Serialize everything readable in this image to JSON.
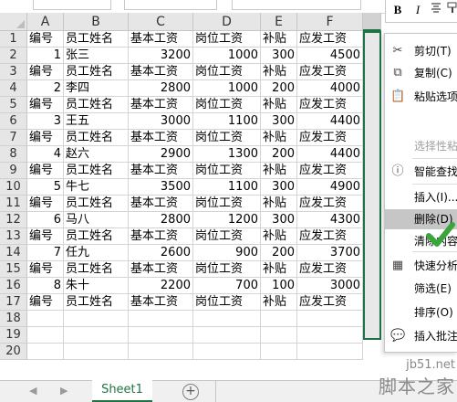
{
  "columns": [
    "A",
    "B",
    "C",
    "D",
    "E",
    "F"
  ],
  "row_numbers": [
    "1",
    "2",
    "3",
    "4",
    "5",
    "6",
    "7",
    "8",
    "9",
    "10",
    "11",
    "12",
    "13",
    "14",
    "15",
    "16",
    "17",
    "18",
    "19",
    "20"
  ],
  "header": [
    "编号",
    "员工姓名",
    "基本工资",
    "岗位工资",
    "补贴",
    "应发工资"
  ],
  "records": [
    [
      "1",
      "张三",
      "3200",
      "1000",
      "300",
      "4500"
    ],
    [
      "2",
      "李四",
      "2800",
      "1000",
      "200",
      "4000"
    ],
    [
      "3",
      "王五",
      "3000",
      "1100",
      "300",
      "4400"
    ],
    [
      "4",
      "赵六",
      "2900",
      "1300",
      "200",
      "4400"
    ],
    [
      "5",
      "牛七",
      "3500",
      "1100",
      "300",
      "4900"
    ],
    [
      "6",
      "马八",
      "2800",
      "1200",
      "300",
      "4300"
    ],
    [
      "7",
      "任九",
      "2600",
      "900",
      "200",
      "3700"
    ],
    [
      "8",
      "朱十",
      "2200",
      "700",
      "100",
      "3000"
    ]
  ],
  "mini_toolbar": {
    "bold": "B",
    "italic": "I"
  },
  "context_menu": {
    "items": [
      {
        "label": "剪切(T)",
        "icon": "scissors-icon"
      },
      {
        "label": "复制(C)",
        "icon": "copy-icon"
      },
      {
        "label": "粘贴选项:",
        "icon": "paste-icon"
      },
      {
        "label": "选择性粘贴",
        "icon": "paste-special-icon"
      },
      {
        "label": "智能查找",
        "icon": "smart-lookup-icon"
      },
      {
        "label": "插入(I)...",
        "icon": ""
      },
      {
        "label": "删除(D)",
        "icon": ""
      },
      {
        "label": "清除内容",
        "icon": ""
      },
      {
        "label": "快速分析",
        "icon": "quick-analysis-icon"
      },
      {
        "label": "筛选(E)",
        "icon": ""
      },
      {
        "label": "排序(O)",
        "icon": ""
      },
      {
        "label": "插入批注",
        "icon": "insert-comment-icon"
      }
    ]
  },
  "sheet_tab": "Sheet1",
  "add_sheet": "+",
  "watermark": {
    "line1": "jb51.net",
    "line2": "脚本之家"
  },
  "colors": {
    "accent": "#217346",
    "check": "#3aa53a"
  }
}
